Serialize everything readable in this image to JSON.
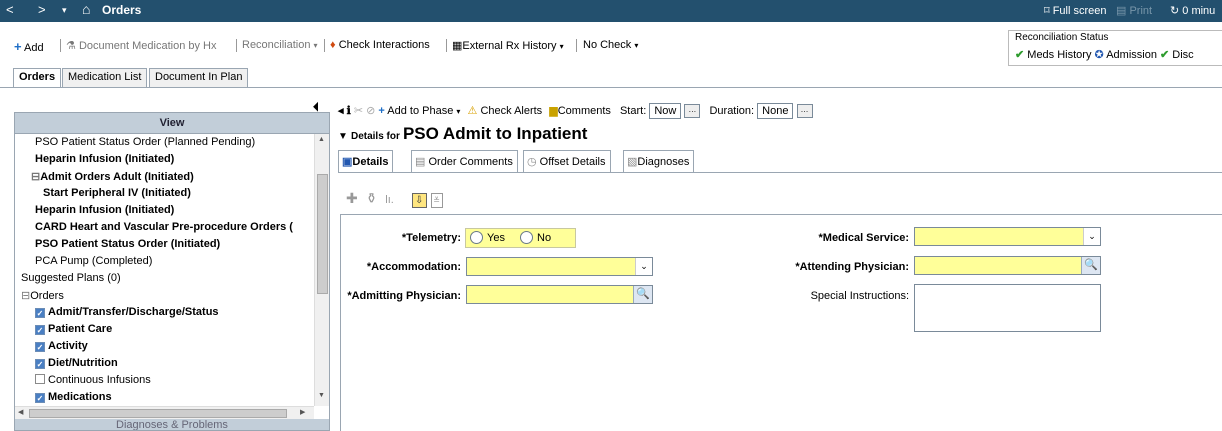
{
  "titlebar": {
    "title": "Orders",
    "back": "<",
    "forward": ">",
    "dropdown": "▾",
    "home": "⌂",
    "full_screen": "Full screen",
    "print": "Print",
    "refresh": "0 minu"
  },
  "toolbar": {
    "add": "Add",
    "document_med": "Document Medication by Hx",
    "reconciliation": "Reconciliation",
    "check_interactions": "Check Interactions",
    "external_rx": "External Rx History",
    "no_check": "No Check"
  },
  "recon_status": {
    "legend": "Reconciliation Status",
    "meds_history": "Meds History",
    "admission": "Admission",
    "disc": "Disc"
  },
  "top_tabs": [
    "Orders",
    "Medication List",
    "Document In Plan"
  ],
  "left_panel": {
    "view_header": "View",
    "tree": [
      {
        "text": "PSO Patient Status Order (Planned Pending)",
        "bold": false,
        "indent": 1
      },
      {
        "text": "Heparin Infusion (Initiated)",
        "bold": true,
        "indent": 1
      },
      {
        "text": "Admit Orders Adult (Initiated)",
        "bold": true,
        "indent": 1
      },
      {
        "text": "Start Peripheral IV (Initiated)",
        "bold": true,
        "indent": 2
      },
      {
        "text": "Heparin Infusion (Initiated)",
        "bold": true,
        "indent": 1
      },
      {
        "text": "CARD Heart and Vascular Pre-procedure Orders (",
        "bold": true,
        "indent": 1
      },
      {
        "text": "PSO Patient Status Order (Initiated)",
        "bold": true,
        "indent": 1
      },
      {
        "text": "PCA Pump (Completed)",
        "bold": false,
        "indent": 1
      },
      {
        "text": "Suggested Plans (0)",
        "bold": false,
        "indent": 0
      },
      {
        "text": "Orders",
        "bold": false,
        "indent": 0
      },
      {
        "text": "Admit/Transfer/Discharge/Status",
        "bold": true,
        "indent": 1,
        "checkbox": "checked"
      },
      {
        "text": "Patient Care",
        "bold": true,
        "indent": 1,
        "checkbox": "checked"
      },
      {
        "text": "Activity",
        "bold": true,
        "indent": 1,
        "checkbox": "checked"
      },
      {
        "text": "Diet/Nutrition",
        "bold": true,
        "indent": 1,
        "checkbox": "checked"
      },
      {
        "text": "Continuous Infusions",
        "bold": false,
        "indent": 1,
        "checkbox": "empty"
      },
      {
        "text": "Medications",
        "bold": true,
        "indent": 1,
        "checkbox": "checked"
      }
    ],
    "diagnoses_bar": "Diagnoses & Problems"
  },
  "phase_bar": {
    "add_to_phase": "Add to Phase",
    "check_alerts": "Check Alerts",
    "comments": "Comments",
    "start_label": "Start:",
    "start_value": "Now",
    "duration_label": "Duration:",
    "duration_value": "None"
  },
  "details": {
    "prefix": "Details for",
    "order_name": "PSO Admit to Inpatient"
  },
  "sub_tabs": [
    "Details",
    "Order Comments",
    "Offset Details",
    "Diagnoses"
  ],
  "form": {
    "telemetry_label": "*Telemetry:",
    "yes": "Yes",
    "no": "No",
    "accommodation_label": "*Accommodation:",
    "admitting_physician_label": "*Admitting Physician:",
    "medical_service_label": "*Medical Service:",
    "attending_physician_label": "*Attending Physician:",
    "special_instructions_label": "Special Instructions:"
  },
  "colors": {
    "title_bar": "#23506e",
    "required_field": "#ffff99",
    "panel_header": "#c2ced9"
  }
}
